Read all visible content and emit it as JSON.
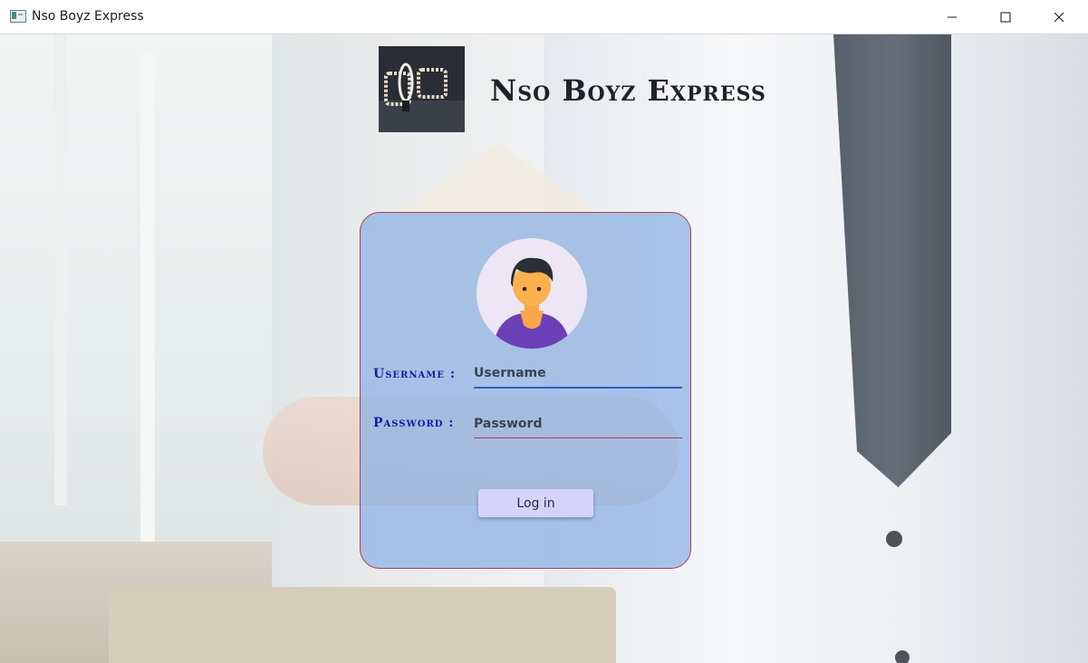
{
  "window": {
    "title": "Nso Boyz Express",
    "icons": {
      "app": "app-window-icon",
      "minimize": "minimize-icon",
      "maximize": "maximize-icon",
      "close": "close-icon"
    }
  },
  "header": {
    "logo": "logo-image",
    "title": "Nso Boyz Express"
  },
  "login": {
    "avatar": "user-avatar-icon",
    "username_label": "Username :",
    "username_placeholder": "Username",
    "password_label": "Password :",
    "password_placeholder": "Password",
    "login_button": "Log in"
  },
  "colors": {
    "card_fill": "#8bb0e4",
    "card_border": "#b23d55",
    "label_text": "#1a1aa0",
    "username_underline": "#2f5fb8",
    "password_underline": "#b23d55",
    "button_bg": "#d6d3fb"
  }
}
